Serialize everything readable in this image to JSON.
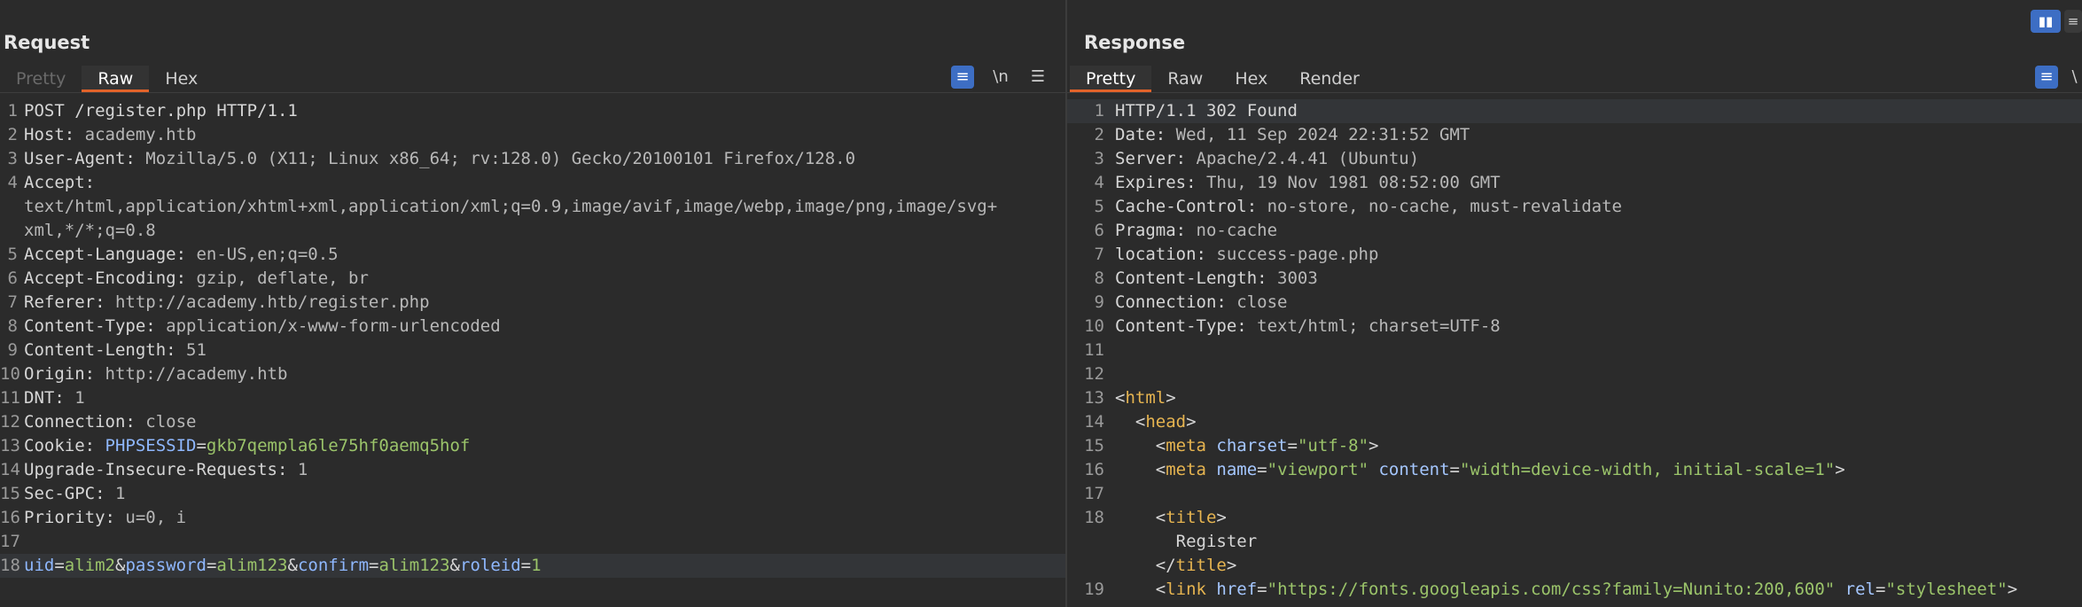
{
  "request": {
    "title": "Request",
    "tabs": [
      "Pretty",
      "Raw",
      "Hex"
    ],
    "active_tab": "Raw",
    "toolbar": {
      "wrap_icon": "≡",
      "newline_label": "\\n",
      "menu_icon": "☰"
    },
    "lines": [
      {
        "n": "1",
        "parts": [
          {
            "t": "POST /register.php HTTP/1.1",
            "c": "k"
          }
        ]
      },
      {
        "n": "2",
        "parts": [
          {
            "t": "Host: ",
            "c": "k"
          },
          {
            "t": "academy.htb",
            "c": "v"
          }
        ]
      },
      {
        "n": "3",
        "parts": [
          {
            "t": "User-Agent: ",
            "c": "k"
          },
          {
            "t": "Mozilla/5.0 (X11; Linux x86_64; rv:128.0) Gecko/20100101 Firefox/128.0",
            "c": "v"
          }
        ]
      },
      {
        "n": "4",
        "parts": [
          {
            "t": "Accept:",
            "c": "k"
          }
        ]
      },
      {
        "n": "",
        "parts": [
          {
            "t": "text/html,application/xhtml+xml,application/xml;q=0.9,image/avif,image/webp,image/png,image/svg+",
            "c": "v"
          }
        ]
      },
      {
        "n": "",
        "parts": [
          {
            "t": "xml,*/*;q=0.8",
            "c": "v"
          }
        ]
      },
      {
        "n": "5",
        "parts": [
          {
            "t": "Accept-Language: ",
            "c": "k"
          },
          {
            "t": "en-US,en;q=0.5",
            "c": "v"
          }
        ]
      },
      {
        "n": "6",
        "parts": [
          {
            "t": "Accept-Encoding: ",
            "c": "k"
          },
          {
            "t": "gzip, deflate, br",
            "c": "v"
          }
        ]
      },
      {
        "n": "7",
        "parts": [
          {
            "t": "Referer: ",
            "c": "k"
          },
          {
            "t": "http://academy.htb/register.php",
            "c": "v"
          }
        ]
      },
      {
        "n": "8",
        "parts": [
          {
            "t": "Content-Type: ",
            "c": "k"
          },
          {
            "t": "application/x-www-form-urlencoded",
            "c": "v"
          }
        ]
      },
      {
        "n": "9",
        "parts": [
          {
            "t": "Content-Length: ",
            "c": "k"
          },
          {
            "t": "51",
            "c": "v"
          }
        ]
      },
      {
        "n": "10",
        "parts": [
          {
            "t": "Origin: ",
            "c": "k"
          },
          {
            "t": "http://academy.htb",
            "c": "v"
          }
        ]
      },
      {
        "n": "11",
        "parts": [
          {
            "t": "DNT: ",
            "c": "k"
          },
          {
            "t": "1",
            "c": "v"
          }
        ]
      },
      {
        "n": "12",
        "parts": [
          {
            "t": "Connection: ",
            "c": "k"
          },
          {
            "t": "close",
            "c": "v"
          }
        ]
      },
      {
        "n": "13",
        "parts": [
          {
            "t": "Cookie: ",
            "c": "k"
          },
          {
            "t": "PHPSESSID",
            "c": "blue"
          },
          {
            "t": "=",
            "c": "k"
          },
          {
            "t": "gkb7qempla6le75hf0aemq5hof",
            "c": "green"
          }
        ]
      },
      {
        "n": "14",
        "parts": [
          {
            "t": "Upgrade-Insecure-Requests: ",
            "c": "k"
          },
          {
            "t": "1",
            "c": "v"
          }
        ]
      },
      {
        "n": "15",
        "parts": [
          {
            "t": "Sec-GPC: ",
            "c": "k"
          },
          {
            "t": "1",
            "c": "v"
          }
        ]
      },
      {
        "n": "16",
        "parts": [
          {
            "t": "Priority: ",
            "c": "k"
          },
          {
            "t": "u=0, i",
            "c": "v"
          }
        ]
      },
      {
        "n": "17",
        "parts": []
      },
      {
        "n": "18",
        "hl": true,
        "parts": [
          {
            "t": "uid",
            "c": "blue"
          },
          {
            "t": "=",
            "c": "k"
          },
          {
            "t": "alim2",
            "c": "green"
          },
          {
            "t": "&",
            "c": "k"
          },
          {
            "t": "password",
            "c": "blue"
          },
          {
            "t": "=",
            "c": "k"
          },
          {
            "t": "alim123",
            "c": "green"
          },
          {
            "t": "&",
            "c": "k"
          },
          {
            "t": "confirm",
            "c": "blue"
          },
          {
            "t": "=",
            "c": "k"
          },
          {
            "t": "alim123",
            "c": "green"
          },
          {
            "t": "&",
            "c": "k"
          },
          {
            "t": "roleid",
            "c": "blue"
          },
          {
            "t": "=",
            "c": "k"
          },
          {
            "t": "1",
            "c": "green"
          }
        ]
      }
    ]
  },
  "response": {
    "title": "Response",
    "tabs": [
      "Pretty",
      "Raw",
      "Hex",
      "Render"
    ],
    "active_tab": "Pretty",
    "toolbar": {
      "wrap_icon": "≡",
      "extra_label": "\\"
    },
    "lines": [
      {
        "n": "1",
        "hl": true,
        "parts": [
          {
            "t": "HTTP/1.1 302 Found",
            "c": "k"
          }
        ]
      },
      {
        "n": "2",
        "parts": [
          {
            "t": "Date: ",
            "c": "k"
          },
          {
            "t": "Wed, 11 Sep 2024 22:31:52 GMT",
            "c": "v"
          }
        ]
      },
      {
        "n": "3",
        "parts": [
          {
            "t": "Server: ",
            "c": "k"
          },
          {
            "t": "Apache/2.4.41 (Ubuntu)",
            "c": "v"
          }
        ]
      },
      {
        "n": "4",
        "parts": [
          {
            "t": "Expires: ",
            "c": "k"
          },
          {
            "t": "Thu, 19 Nov 1981 08:52:00 GMT",
            "c": "v"
          }
        ]
      },
      {
        "n": "5",
        "parts": [
          {
            "t": "Cache-Control: ",
            "c": "k"
          },
          {
            "t": "no-store, no-cache, must-revalidate",
            "c": "v"
          }
        ]
      },
      {
        "n": "6",
        "parts": [
          {
            "t": "Pragma: ",
            "c": "k"
          },
          {
            "t": "no-cache",
            "c": "v"
          }
        ]
      },
      {
        "n": "7",
        "parts": [
          {
            "t": "location: ",
            "c": "k"
          },
          {
            "t": "success-page.php",
            "c": "v"
          }
        ]
      },
      {
        "n": "8",
        "parts": [
          {
            "t": "Content-Length: ",
            "c": "k"
          },
          {
            "t": "3003",
            "c": "v"
          }
        ]
      },
      {
        "n": "9",
        "parts": [
          {
            "t": "Connection: ",
            "c": "k"
          },
          {
            "t": "close",
            "c": "v"
          }
        ]
      },
      {
        "n": "10",
        "parts": [
          {
            "t": "Content-Type: ",
            "c": "k"
          },
          {
            "t": "text/html; charset=UTF-8",
            "c": "v"
          }
        ]
      },
      {
        "n": "11",
        "parts": []
      },
      {
        "n": "12",
        "parts": []
      },
      {
        "n": "13",
        "parts": [
          {
            "t": "<",
            "c": "punct"
          },
          {
            "t": "html",
            "c": "tag"
          },
          {
            "t": ">",
            "c": "punct"
          }
        ]
      },
      {
        "n": "14",
        "parts": [
          {
            "t": "  <",
            "c": "punct"
          },
          {
            "t": "head",
            "c": "tag"
          },
          {
            "t": ">",
            "c": "punct"
          }
        ]
      },
      {
        "n": "15",
        "parts": [
          {
            "t": "    <",
            "c": "punct"
          },
          {
            "t": "meta ",
            "c": "tag"
          },
          {
            "t": "charset",
            "c": "attr"
          },
          {
            "t": "=",
            "c": "punct"
          },
          {
            "t": "\"utf-8\"",
            "c": "str"
          },
          {
            "t": ">",
            "c": "punct"
          }
        ]
      },
      {
        "n": "16",
        "parts": [
          {
            "t": "    <",
            "c": "punct"
          },
          {
            "t": "meta ",
            "c": "tag"
          },
          {
            "t": "name",
            "c": "attr"
          },
          {
            "t": "=",
            "c": "punct"
          },
          {
            "t": "\"viewport\" ",
            "c": "str"
          },
          {
            "t": "content",
            "c": "attr"
          },
          {
            "t": "=",
            "c": "punct"
          },
          {
            "t": "\"width=device-width, initial-scale=1\"",
            "c": "str"
          },
          {
            "t": ">",
            "c": "punct"
          }
        ]
      },
      {
        "n": "17",
        "parts": []
      },
      {
        "n": "18",
        "parts": [
          {
            "t": "    <",
            "c": "punct"
          },
          {
            "t": "title",
            "c": "tag"
          },
          {
            "t": ">",
            "c": "punct"
          }
        ]
      },
      {
        "n": "",
        "parts": [
          {
            "t": "      Register",
            "c": "k"
          }
        ]
      },
      {
        "n": "",
        "parts": [
          {
            "t": "    </",
            "c": "punct"
          },
          {
            "t": "title",
            "c": "tag"
          },
          {
            "t": ">",
            "c": "punct"
          }
        ]
      },
      {
        "n": "19",
        "parts": [
          {
            "t": "    <",
            "c": "punct"
          },
          {
            "t": "link ",
            "c": "tag"
          },
          {
            "t": "href",
            "c": "attr"
          },
          {
            "t": "=",
            "c": "punct"
          },
          {
            "t": "\"https://fonts.googleapis.com/css?family=Nunito:200,600\" ",
            "c": "str"
          },
          {
            "t": "rel",
            "c": "attr"
          },
          {
            "t": "=",
            "c": "punct"
          },
          {
            "t": "\"stylesheet\"",
            "c": "str"
          },
          {
            "t": ">",
            "c": "punct"
          }
        ]
      }
    ]
  },
  "layout_toggle": {
    "split_icon": "▮▮",
    "stack_icon": "≡"
  }
}
